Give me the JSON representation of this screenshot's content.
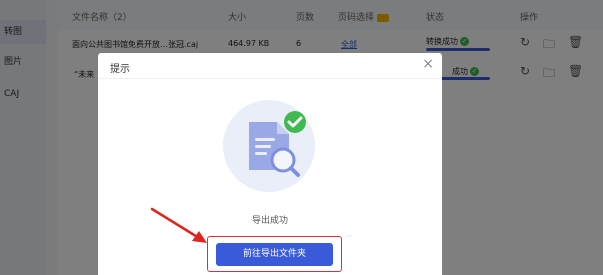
{
  "sidebar": {
    "items": [
      {
        "label": "转图"
      },
      {
        "label": "图片"
      },
      {
        "label": "CAJ"
      }
    ]
  },
  "table": {
    "headers": {
      "name": "文件名称（2）",
      "size": "大小",
      "pages": "页数",
      "page_select": "页码选择",
      "status": "状态",
      "actions": "操作"
    },
    "rows": [
      {
        "name": "面向公共图书馆免费开放…张冠.caj",
        "size": "464.97 KB",
        "pages": "6",
        "page_select": "全部",
        "status": "转换成功"
      },
      {
        "name": "“未来",
        "size": "",
        "pages": "",
        "page_select": "",
        "status": "成功"
      }
    ]
  },
  "dialog": {
    "title": "提示",
    "close_symbol": "×",
    "message": "导出成功",
    "button_label": "前往导出文件夹"
  },
  "colors": {
    "primary": "#3a5bd9",
    "success": "#3fb950",
    "highlight": "#d6303b"
  }
}
